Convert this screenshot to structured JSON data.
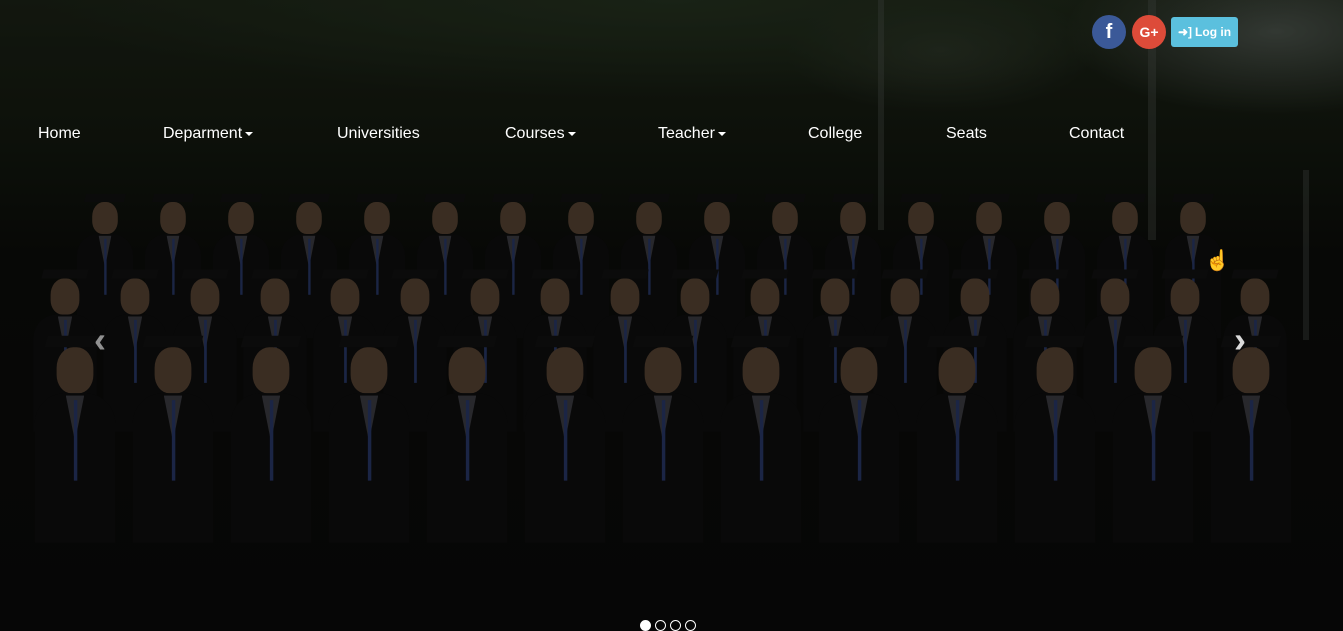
{
  "topbar": {
    "facebook_icon": "facebook-icon",
    "facebook_glyph": "f",
    "googleplus_icon": "google-plus-icon",
    "googleplus_glyph": "G+",
    "login_label": "Log in",
    "login_icon": "sign-in-icon",
    "colors": {
      "facebook": "#3b5998",
      "googleplus": "#dd4b39",
      "login": "#5bc0de"
    }
  },
  "nav": {
    "items": [
      {
        "label": "Home",
        "dropdown": false
      },
      {
        "label": "Deparment",
        "dropdown": true
      },
      {
        "label": "Universities",
        "dropdown": false
      },
      {
        "label": "Courses",
        "dropdown": true
      },
      {
        "label": "Teacher",
        "dropdown": true
      },
      {
        "label": "College",
        "dropdown": false
      },
      {
        "label": "Seats",
        "dropdown": false
      },
      {
        "label": "Contact",
        "dropdown": false
      }
    ]
  },
  "carousel": {
    "prev_icon": "chevron-left-icon",
    "next_icon": "chevron-right-icon",
    "slide_count": 4,
    "active_slide": 1
  }
}
